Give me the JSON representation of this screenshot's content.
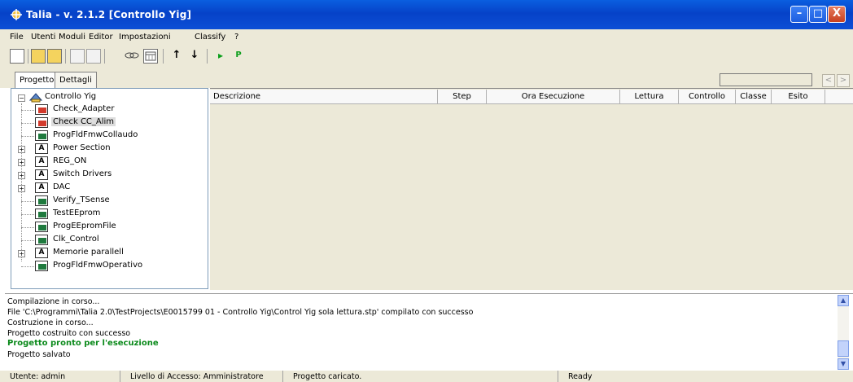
{
  "window": {
    "title": "Talia - v. 2.1.2  [Controllo Yig]",
    "controls": {
      "minimize": "–",
      "maximize": "□",
      "close": "X"
    }
  },
  "menu": [
    "File",
    "Utenti",
    "Moduli",
    "Editor",
    "Impostazioni",
    "Classify",
    "?"
  ],
  "toolbar": {
    "icons": [
      "new-icon",
      "open-icon",
      "open-folder-icon",
      "save-icon",
      "print-icon",
      "link-icon",
      "calendar-icon",
      "arrow-up-icon",
      "arrow-down-icon",
      "play-icon",
      "pause-icon"
    ],
    "arrow_up": "↑",
    "arrow_down": "↓",
    "play": "▸",
    "pause": "P"
  },
  "tabs": [
    "Progetto",
    "Dettagli"
  ],
  "nav": {
    "prev": "<",
    "next": ">"
  },
  "tree": {
    "root": "Controllo Yig",
    "items": [
      {
        "label": "Check_Adapter",
        "type": "check"
      },
      {
        "label": "Check CC_Alim",
        "type": "check",
        "selected": true
      },
      {
        "label": "ProgFldFmwCollaudo",
        "type": "prog"
      },
      {
        "label": "Power Section",
        "type": "folder",
        "expandable": true
      },
      {
        "label": "REG_ON",
        "type": "folder",
        "expandable": true
      },
      {
        "label": "Switch Drivers",
        "type": "folder",
        "expandable": true
      },
      {
        "label": "DAC",
        "type": "folder",
        "expandable": true
      },
      {
        "label": "Verify_TSense",
        "type": "prog"
      },
      {
        "label": "TestEEprom",
        "type": "prog"
      },
      {
        "label": "ProgEEpromFile",
        "type": "prog"
      },
      {
        "label": "Clk_Control",
        "type": "prog"
      },
      {
        "label": "Memorie parallell",
        "type": "folder",
        "expandable": true
      },
      {
        "label": "ProgFldFmwOperativo",
        "type": "prog"
      }
    ]
  },
  "grid": {
    "columns": [
      "Descrizione",
      "Step",
      "Ora Esecuzione",
      "Lettura",
      "Controllo",
      "Classe",
      "Esito"
    ]
  },
  "log": {
    "lines": [
      {
        "text": "Compilazione in corso...",
        "highlight": false
      },
      {
        "text": "File 'C:\\Programmi\\Talia 2.0\\TestProjects\\E0015799 01 - Controllo Yig\\Control Yig sola lettura.stp' compilato con successo",
        "highlight": false
      },
      {
        "text": "Costruzione in corso...",
        "highlight": false
      },
      {
        "text": "Progetto costruito con successo",
        "highlight": false
      },
      {
        "text": "Progetto pronto per l'esecuzione",
        "highlight": true
      },
      {
        "text": "Progetto salvato",
        "highlight": false
      }
    ]
  },
  "status": {
    "user": "Utente: admin",
    "access": "Livello di Accesso: Amministratore",
    "project": "Progetto caricato.",
    "state": "Ready"
  },
  "colors": {
    "titlebar": "#0642c8",
    "success": "#0b8a1b",
    "chrome": "#ece9d8"
  }
}
